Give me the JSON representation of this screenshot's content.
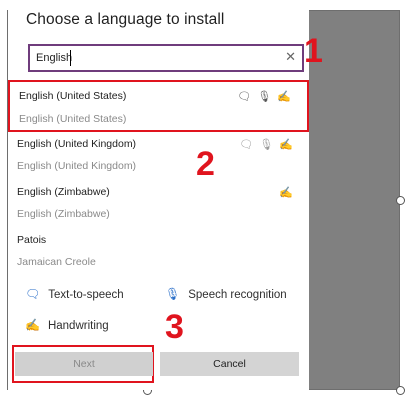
{
  "dialog": {
    "title": "Choose a language to install",
    "search": {
      "value": "English",
      "clear_icon": "✕"
    }
  },
  "languages": [
    {
      "name": "English (United States)",
      "native": "English (United States)",
      "features": "🗨🎙✍",
      "selected": true
    },
    {
      "name": "English (United Kingdom)",
      "native": "English (United Kingdom)",
      "features": "🗨🎙✍",
      "selected": false
    },
    {
      "name": "English (Zimbabwe)",
      "native": "English (Zimbabwe)",
      "features": "✍",
      "selected": false
    },
    {
      "name": "Patois",
      "native": "Jamaican Creole",
      "features": "",
      "selected": false
    }
  ],
  "legend": {
    "tts": "Text-to-speech",
    "speech": "Speech recognition",
    "handwriting": "Handwriting",
    "tts_icon": "🗨",
    "speech_icon": "🎙",
    "handwriting_icon": "✍"
  },
  "buttons": {
    "next": "Next",
    "cancel": "Cancel"
  },
  "annotations": {
    "one": "1",
    "two": "2",
    "three": "3"
  },
  "colors": {
    "accent_red": "#e0141e",
    "search_border": "#6f3c7c",
    "icon_blue": "#2a6fc9"
  }
}
